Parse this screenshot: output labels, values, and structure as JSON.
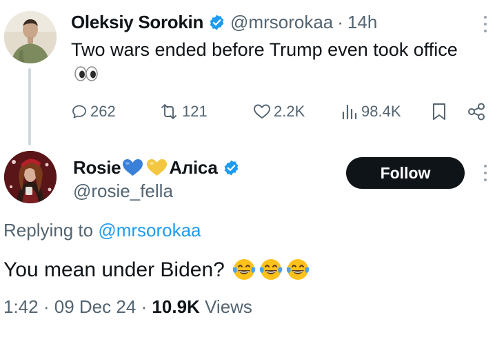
{
  "tweet": {
    "author_name": "Oleksiy Sorokin",
    "handle": "@mrsorokaa",
    "separator": "·",
    "time": "14h",
    "text": "Two wars ended before Trump even took office",
    "emoji": "eyes",
    "actions": {
      "replies": "262",
      "retweets": "121",
      "likes": "2.2K",
      "views": "98.4K"
    }
  },
  "reply": {
    "name_part1": "Rosie",
    "name_part2": "Алiса",
    "name_hearts": [
      "blue-heart",
      "yellow-heart"
    ],
    "handle": "@rosie_fella",
    "follow_label": "Follow",
    "replying_label": "Replying to",
    "replying_to": "@mrsorokaa",
    "text": "You mean under Biden?",
    "emojis": [
      "laughing-tears",
      "laughing-tears",
      "laughing-tears"
    ],
    "timestamp_time": "1:42",
    "timestamp_sep": "·",
    "timestamp_date": "09 Dec 24",
    "views_count": "10.9K",
    "views_label": "Views"
  },
  "colors": {
    "text_primary": "#0f1419",
    "text_secondary": "#536471",
    "link": "#1d9bf0",
    "verified": "#1d9bf0",
    "follow_bg": "#0f1419"
  }
}
